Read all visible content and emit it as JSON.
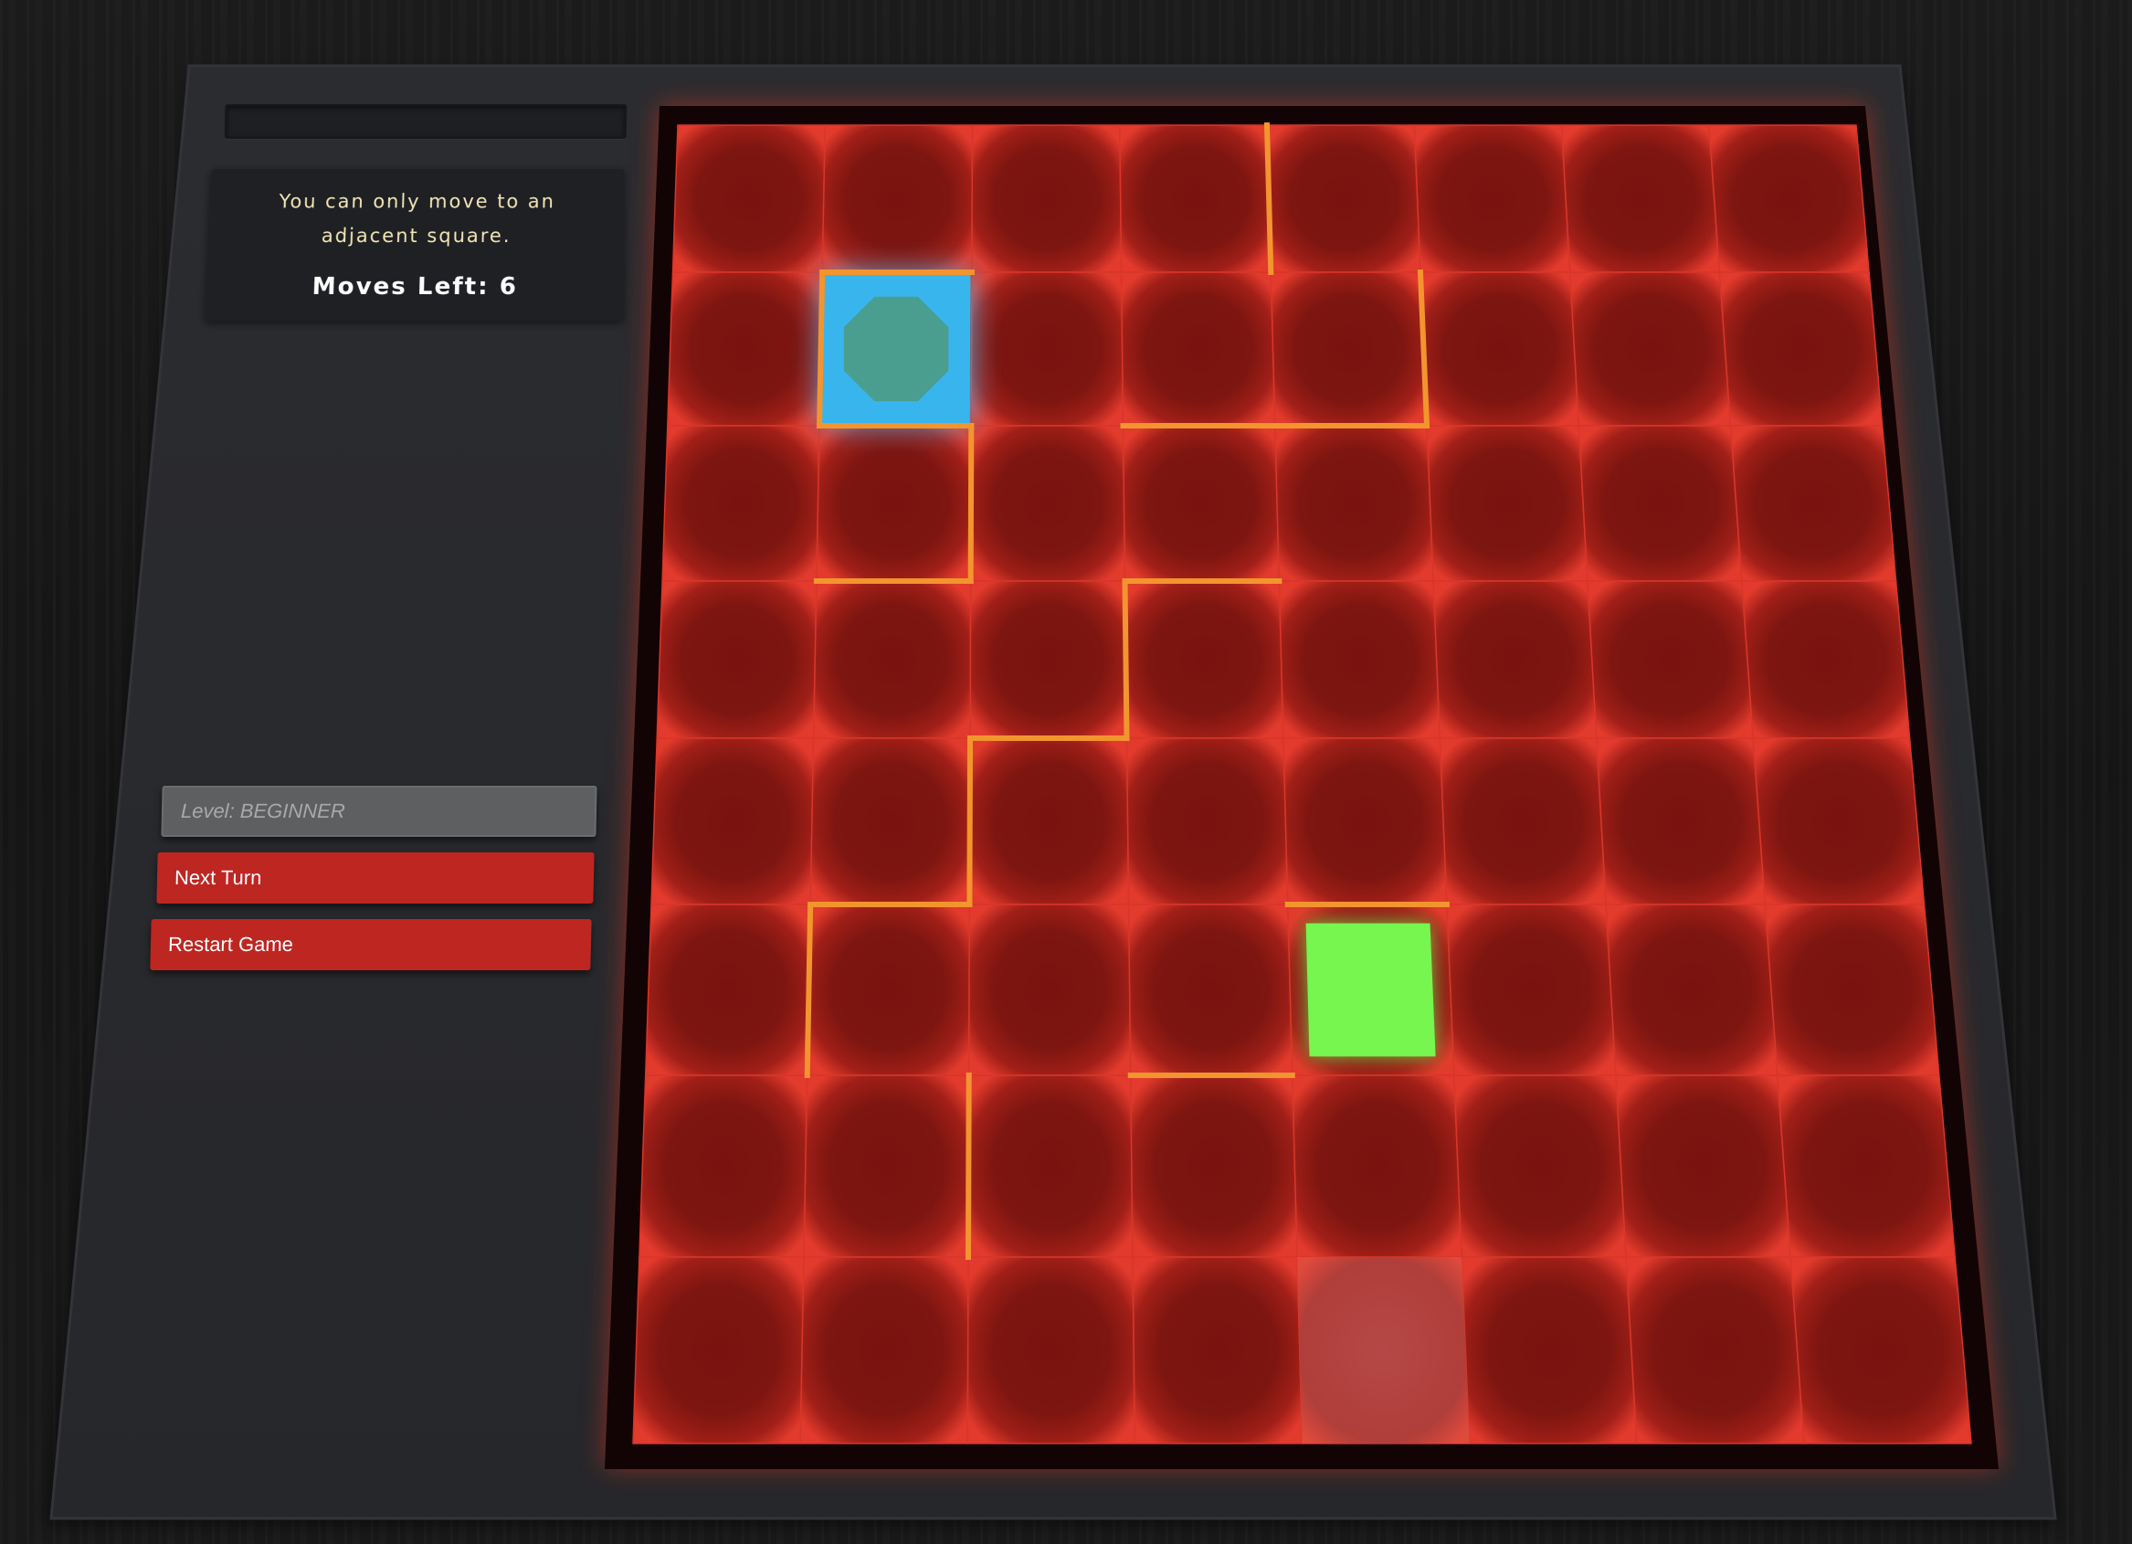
{
  "status": {
    "message": "You can only move to an adjacent square.",
    "moves_left_label": "Moves Left: 6",
    "progress": 0
  },
  "controls": {
    "level_label": "Level: BEGINNER",
    "next_turn_label": "Next Turn",
    "restart_label": "Restart Game"
  },
  "board": {
    "rows": 8,
    "cols": 8,
    "player": {
      "row": 1,
      "col": 1,
      "shape": "octagon",
      "color": "#4a9e8f",
      "highlight": "#39b5ee"
    },
    "goal": {
      "row": 5,
      "col": 4,
      "color": "#76f64e"
    },
    "hover_cell": {
      "row": 7,
      "col": 4
    },
    "walls_h": [
      {
        "row": 1,
        "col": 1
      },
      {
        "row": 2,
        "col": 1
      },
      {
        "row": 2,
        "col": 3
      },
      {
        "row": 2,
        "col": 4
      },
      {
        "row": 3,
        "col": 1
      },
      {
        "row": 3,
        "col": 3
      },
      {
        "row": 4,
        "col": 2
      },
      {
        "row": 5,
        "col": 1
      },
      {
        "row": 5,
        "col": 4
      },
      {
        "row": 6,
        "col": 3
      }
    ],
    "walls_v": [
      {
        "row": 0,
        "col": 4
      },
      {
        "row": 1,
        "col": 1
      },
      {
        "row": 1,
        "col": 5
      },
      {
        "row": 2,
        "col": 2
      },
      {
        "row": 3,
        "col": 3
      },
      {
        "row": 4,
        "col": 2
      },
      {
        "row": 5,
        "col": 1
      },
      {
        "row": 6,
        "col": 2
      }
    ],
    "colors": {
      "cell": "#7b1410",
      "cell_glow": "#e8382a",
      "wall": "#f2952e",
      "hover": "#b04040"
    }
  }
}
